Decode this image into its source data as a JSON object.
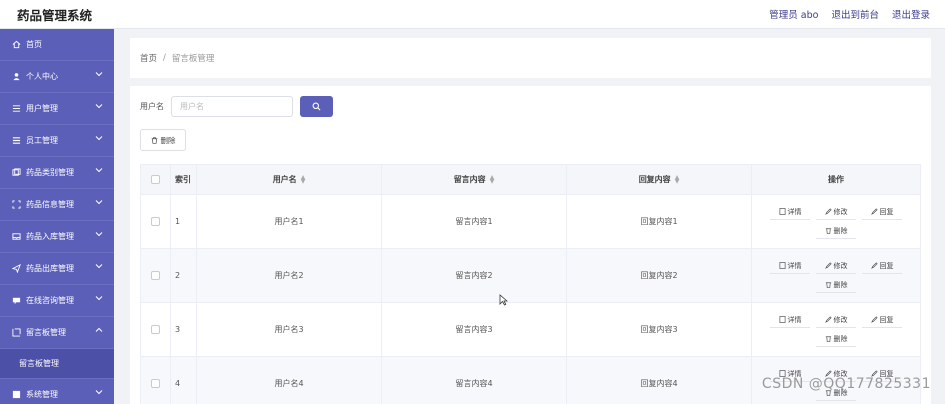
{
  "app": {
    "title": "药品管理系统"
  },
  "header": {
    "links": [
      "管理员 abo",
      "退出到前台",
      "退出登录"
    ]
  },
  "sidebar": {
    "items": [
      {
        "label": "首页",
        "icon": "home-icon",
        "has_chevron": false
      },
      {
        "label": "个人中心",
        "icon": "user-icon",
        "has_chevron": true
      },
      {
        "label": "用户管理",
        "icon": "list-icon",
        "has_chevron": true
      },
      {
        "label": "员工管理",
        "icon": "menu-icon",
        "has_chevron": true
      },
      {
        "label": "药品类别管理",
        "icon": "category-icon",
        "has_chevron": true
      },
      {
        "label": "药品信息管理",
        "icon": "frame-icon",
        "has_chevron": true
      },
      {
        "label": "药品入库管理",
        "icon": "inbox-icon",
        "has_chevron": true
      },
      {
        "label": "药品出库管理",
        "icon": "send-icon",
        "has_chevron": true
      },
      {
        "label": "在线咨询管理",
        "icon": "chat-icon",
        "has_chevron": true
      },
      {
        "label": "留言板管理",
        "icon": "board-icon",
        "has_chevron": true,
        "expanded": true
      },
      {
        "label": "系统管理",
        "icon": "system-icon",
        "has_chevron": true
      }
    ],
    "submenu": {
      "label": "留言板管理"
    }
  },
  "breadcrumb": {
    "home": "首页",
    "separator": "/",
    "current": "留言板管理"
  },
  "search": {
    "label": "用户名",
    "placeholder": "用户名"
  },
  "toolbar": {
    "delete_label": "删除"
  },
  "table": {
    "columns": [
      "索引",
      "用户名",
      "留言内容",
      "回复内容",
      "操作"
    ],
    "rows": [
      {
        "index": "1",
        "username": "用户名1",
        "message": "留言内容1",
        "reply": "回复内容1"
      },
      {
        "index": "2",
        "username": "用户名2",
        "message": "留言内容2",
        "reply": "回复内容2"
      },
      {
        "index": "3",
        "username": "用户名3",
        "message": "留言内容3",
        "reply": "回复内容3"
      },
      {
        "index": "4",
        "username": "用户名4",
        "message": "留言内容4",
        "reply": "回复内容4"
      }
    ],
    "row_actions": [
      "详情",
      "修改",
      "回复",
      "删除"
    ]
  },
  "watermark": "CSDN @QQ177825331",
  "colors": {
    "primary": "#5b5fb8",
    "sidebar_border": "#6b6fc4",
    "submenu_bg": "#4c50a6"
  }
}
